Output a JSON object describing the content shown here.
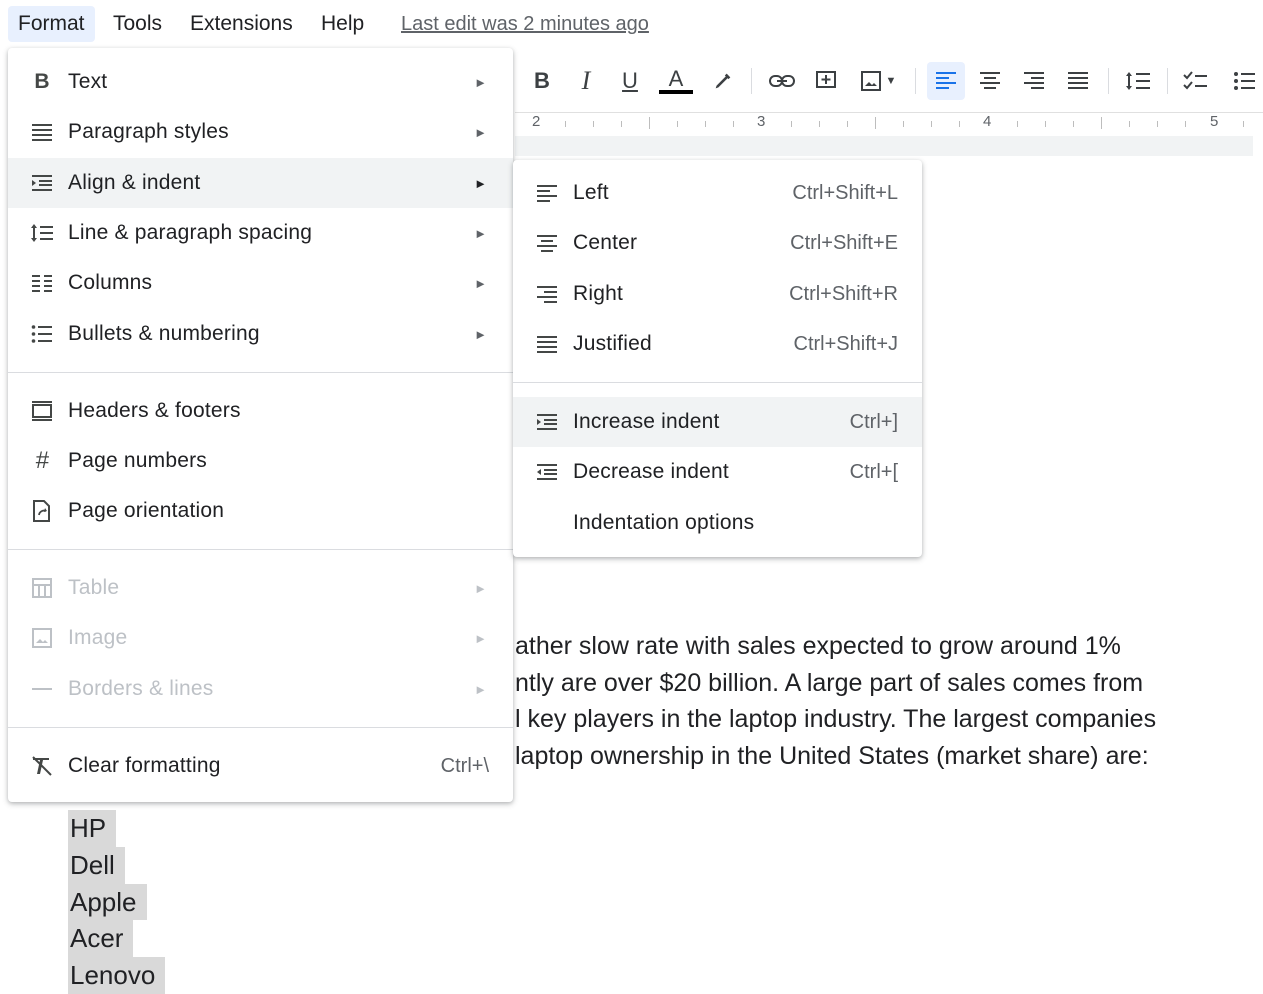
{
  "menubar": {
    "items": [
      "Format",
      "Tools",
      "Extensions",
      "Help"
    ],
    "last_edit": "Last edit was 2 minutes ago"
  },
  "toolbar": {
    "icons": [
      "bold-icon",
      "italic-icon",
      "underline-icon",
      "text-color-icon",
      "highlight-icon",
      "link-icon",
      "comment-icon",
      "image-icon",
      "align-left-icon",
      "align-center-icon",
      "align-right-icon",
      "align-justify-icon",
      "line-spacing-icon",
      "checklist-icon",
      "bullet-list-icon"
    ]
  },
  "ruler": {
    "numbers": [
      "2",
      "3",
      "4",
      "5"
    ]
  },
  "format_menu": {
    "items": [
      {
        "label": "Text",
        "icon": "bold-icon"
      },
      {
        "label": "Paragraph styles",
        "icon": "paragraph-styles-icon"
      },
      {
        "label": "Align & indent",
        "icon": "align-indent-icon"
      },
      {
        "label": "Line & paragraph spacing",
        "icon": "line-spacing-icon"
      },
      {
        "label": "Columns",
        "icon": "columns-icon"
      },
      {
        "label": "Bullets & numbering",
        "icon": "bullets-icon"
      },
      {
        "label": "Headers & footers",
        "icon": "header-footer-icon"
      },
      {
        "label": "Page numbers",
        "icon": "hash-icon"
      },
      {
        "label": "Page orientation",
        "icon": "page-orientation-icon"
      },
      {
        "label": "Table",
        "icon": "table-icon"
      },
      {
        "label": "Image",
        "icon": "image-icon"
      },
      {
        "label": "Borders & lines",
        "icon": "borders-icon"
      },
      {
        "label": "Clear formatting",
        "icon": "clear-formatting-icon",
        "shortcut": "Ctrl+\\"
      }
    ]
  },
  "align_menu": {
    "items": [
      {
        "label": "Left",
        "shortcut": "Ctrl+Shift+L",
        "icon": "align-left-icon"
      },
      {
        "label": "Center",
        "shortcut": "Ctrl+Shift+E",
        "icon": "align-center-icon"
      },
      {
        "label": "Right",
        "shortcut": "Ctrl+Shift+R",
        "icon": "align-right-icon"
      },
      {
        "label": "Justified",
        "shortcut": "Ctrl+Shift+J",
        "icon": "align-justify-icon"
      },
      {
        "label": "Increase indent",
        "shortcut": "Ctrl+]",
        "icon": "increase-indent-icon"
      },
      {
        "label": "Decrease indent",
        "shortcut": "Ctrl+[",
        "icon": "decrease-indent-icon"
      },
      {
        "label": "Indentation options"
      }
    ]
  },
  "document": {
    "lines": [
      "ather slow rate with sales expected to grow around 1%",
      "ntly are over $20 billion.  A large part of sales comes from",
      "l key players in the laptop industry.  The largest companies",
      "laptop ownership in the United States (market share) are:"
    ],
    "list": [
      "HP",
      "Dell",
      "Apple",
      "Acer",
      "Lenovo"
    ]
  }
}
